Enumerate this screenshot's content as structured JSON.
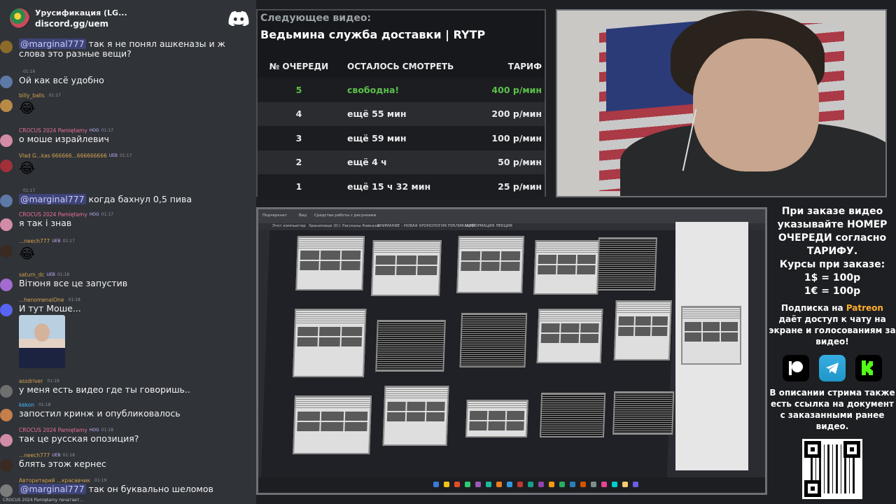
{
  "chat": {
    "server_name": "Урусификация (LG...",
    "server_invite": "discord.gg/uem",
    "messages": [
      {
        "id": 1,
        "user": "",
        "badge": "",
        "time": "",
        "text_prefix": "@marginal777",
        "text": " так я не понял ашкеназы и ж слова это разные вещи?",
        "avatar_color": "#8b6b2a"
      },
      {
        "id": 2,
        "user": "",
        "badge": "",
        "time": "01:16",
        "text": "Ой как всё удобно",
        "avatar_color": "#5d7aa6"
      },
      {
        "id": 3,
        "user": "billy_balls",
        "badge": "",
        "time": "01:17",
        "text": "",
        "emoji": "😂",
        "avatar_color": "#b88a47"
      },
      {
        "id": 4,
        "user": "CROCUS 2024 Pamiętamy",
        "badge": "HOG",
        "time": "01:17",
        "text": "о моше израйлевич",
        "avatar_color": "#d28ca6"
      },
      {
        "id": 5,
        "user": "Vlad G...kas 666666...666666666",
        "badge": "UEB",
        "time": "01:17",
        "text": "",
        "emoji": "😂",
        "avatar_color": "#a0303a"
      },
      {
        "id": 6,
        "user": "",
        "badge": "",
        "time": "01:17",
        "text_prefix": "@marginal777",
        "text": " когда бахнул 0,5 пива",
        "avatar_color": "#5d7aa6"
      },
      {
        "id": 7,
        "user": "CROCUS 2024 Pamiętamy",
        "badge": "HOG",
        "time": "01:17",
        "text": "я так і знав",
        "avatar_color": "#d28ca6"
      },
      {
        "id": 8,
        "user": "...neech777",
        "badge": "UEB",
        "time": "01:17",
        "text": "",
        "emoji": "😂",
        "avatar_color": "#3a2a22"
      },
      {
        "id": 9,
        "user": "saturn_dc",
        "badge": "UEB",
        "time": "01:18",
        "text": "Вітюня все це запустив",
        "avatar_color": "#a36bd0"
      },
      {
        "id": 10,
        "user": "...henomenalOne",
        "badge": "",
        "time": "01:18",
        "text": "И тут Моше...",
        "avatar_color": "#5865f2",
        "has_image": true
      },
      {
        "id": 11,
        "user": "assdriver",
        "badge": "",
        "time": "01:18",
        "text": "у меня есть видео где ты говоришь..",
        "avatar_color": "#6f6f6f"
      },
      {
        "id": 12,
        "user": "kekon",
        "badge": "",
        "time": "01:18",
        "text": "запостил кринж и опубликовалось",
        "avatar_color": "#c47f4a"
      },
      {
        "id": 13,
        "user": "CROCUS 2024 Pamiętamy",
        "badge": "HOG",
        "time": "01:18",
        "text": "так це русская опозиция?",
        "avatar_color": "#d28ca6"
      },
      {
        "id": 14,
        "user": "...neech777",
        "badge": "UEB",
        "time": "01:18",
        "text": "блять этож кернес",
        "avatar_color": "#3a2a22"
      },
      {
        "id": 15,
        "user": "Авторитарий ...красавчик",
        "badge": "",
        "time": "01:19",
        "text_prefix": "@marginal777",
        "text": " так он буквально шеломов",
        "avatar_color": "#7c7c7c"
      }
    ],
    "ticker": "CROCUS 2024 Pamiętamy печатает..."
  },
  "next_video": {
    "label": "Следующее видео:",
    "title": "Ведьмина служба доставки | RYTP",
    "headers": [
      "№ ОЧЕРЕДИ",
      "ОСТАЛОСЬ СМОТРЕТЬ",
      "ТАРИФ"
    ],
    "rows": [
      {
        "queue": "5",
        "remaining": "свободна!",
        "rate": "400 р/мин",
        "free": true
      },
      {
        "queue": "4",
        "remaining": "ещё 55 мин",
        "rate": "200 р/мин",
        "free": false
      },
      {
        "queue": "3",
        "remaining": "ещё 59 мин",
        "rate": "100 р/мин",
        "free": false
      },
      {
        "queue": "2",
        "remaining": "ещё 4 ч",
        "rate": "50 р/мин",
        "free": false
      },
      {
        "queue": "1",
        "remaining": "ещё 15 ч 32 мин",
        "rate": "25 р/мин",
        "free": false
      }
    ],
    "free_color": "#5bc04a"
  },
  "screen": {
    "tabs": [
      "Подчеркнет",
      "Вид",
      "Средства работы с рисунками"
    ],
    "breadcrumbs": [
      "Этот компьютер",
      "Хранилище (D:)",
      "Рассказы Кавказы",
      "ВНИМАНИЕ - НОВАЯ ХРОНОЛОГИЯ ПУБЛИКАЦИЙ",
      "ИНФОРМАЦИЯ ЛЕКЦИЯ"
    ]
  },
  "info": {
    "order_text": "При заказе видео указывайте НОМЕР ОЧЕРЕДИ согласно ТАРИФУ.",
    "rates_title": "Курсы при заказе:",
    "rate_usd": "1$ = 100р",
    "rate_eur": "1€ = 100р",
    "sub_before": "Подписка на ",
    "sub_patreon": "Patreon",
    "sub_after": " даёт доступ к чату на экране и голосованиям за видео!",
    "desc": "В описании стрима также есть ссылка на документ с заказанными ранее видео.",
    "socials": [
      "patreon-icon",
      "telegram-icon",
      "kick-icon"
    ],
    "patreon_color": "#ffae2a",
    "kick_color": "#53fc18"
  }
}
